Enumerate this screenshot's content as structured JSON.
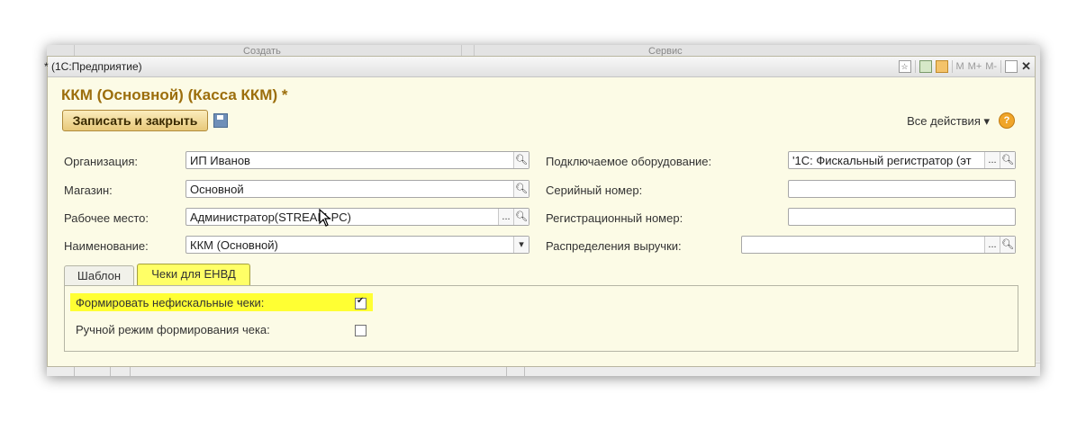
{
  "background": {
    "menu_left": "Создать",
    "menu_right": "Сервис"
  },
  "window": {
    "title": "* (1С:Предприятие)",
    "toolbar_text": [
      "M",
      "M+",
      "M-"
    ]
  },
  "form": {
    "title": "ККМ (Основной) (Касса ККМ) *",
    "save_close_label": "Записать и закрыть",
    "all_actions_label": "Все действия ▾",
    "help_label": "?",
    "left_fields": [
      {
        "label": "Организация:",
        "value": "ИП Иванов"
      },
      {
        "label": "Магазин:",
        "value": "Основной"
      },
      {
        "label": "Рабочее место:",
        "value": "Администратор(STREAM-PC)"
      },
      {
        "label": "Наименование:",
        "value": "ККМ (Основной)"
      }
    ],
    "right_fields": [
      {
        "label": "Подключаемое оборудование:",
        "value": "'1С: Фискальный регистратор (эт"
      },
      {
        "label": "Серийный номер:",
        "value": ""
      },
      {
        "label": "Регистрационный номер:",
        "value": ""
      },
      {
        "label": "Распределения выручки:",
        "value": ""
      }
    ],
    "tabs": [
      {
        "label": "Шаблон",
        "active": false
      },
      {
        "label": "Чеки для ЕНВД",
        "active": true
      }
    ],
    "checkboxes": [
      {
        "label": "Формировать нефискальные чеки:",
        "checked": true
      },
      {
        "label": "Ручной режим формирования чека:",
        "checked": false
      }
    ]
  },
  "colors": {
    "title_color": "#9c6e0c",
    "highlight": "#ffff33",
    "window_bg": "#fcfbe6"
  }
}
